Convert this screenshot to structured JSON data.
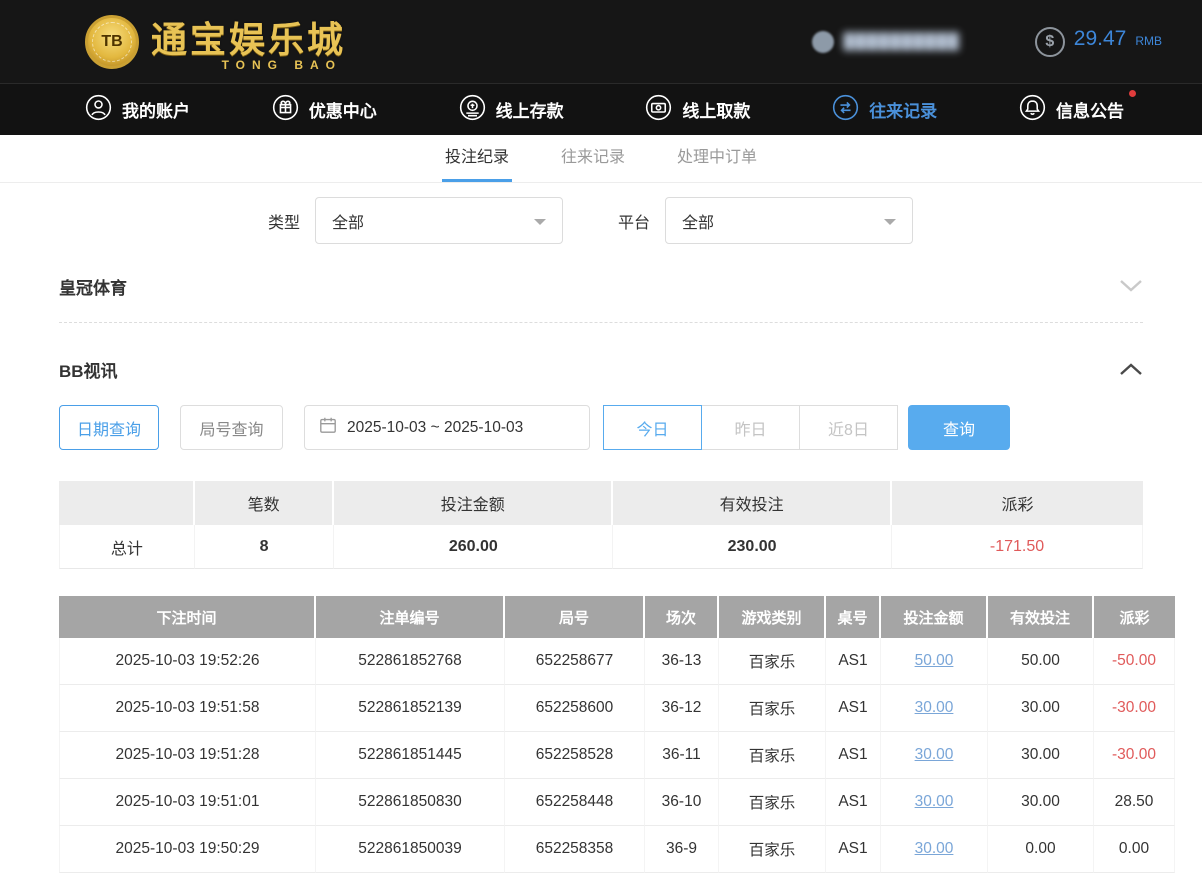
{
  "brand": {
    "badge": "TB",
    "name": "通宝娱乐城",
    "latin": "TONG BAO"
  },
  "topbar": {
    "user_name_masked": "██████████",
    "balance_symbol": "$",
    "balance_amount": "29.47",
    "balance_currency": "RMB"
  },
  "nav": {
    "items": [
      {
        "label": "我的账户"
      },
      {
        "label": "优惠中心"
      },
      {
        "label": "线上存款"
      },
      {
        "label": "线上取款"
      },
      {
        "label": "往来记录"
      },
      {
        "label": "信息公告"
      }
    ]
  },
  "tabs": {
    "items": [
      {
        "label": "投注纪录"
      },
      {
        "label": "往来记录"
      },
      {
        "label": "处理中订单"
      }
    ]
  },
  "filters": {
    "type_label": "类型",
    "type_value": "全部",
    "platform_label": "平台",
    "platform_value": "全部"
  },
  "sections": {
    "crown_sports": "皇冠体育",
    "bb_video": "BB视讯"
  },
  "query": {
    "date_query": "日期查询",
    "round_query": "局号查询",
    "date_range": "2025-10-03 ~ 2025-10-03",
    "today": "今日",
    "yesterday": "昨日",
    "last8": "近8日",
    "search": "查询"
  },
  "summary": {
    "headers": {
      "count": "笔数",
      "bet": "投注金额",
      "valid": "有效投注",
      "payout": "派彩"
    },
    "total_label": "总计",
    "count": "8",
    "bet": "260.00",
    "valid": "230.00",
    "payout": "-171.50"
  },
  "table": {
    "headers": [
      "下注时间",
      "注单编号",
      "局号",
      "场次",
      "游戏类别",
      "桌号",
      "投注金额",
      "有效投注",
      "派彩"
    ],
    "rows": [
      {
        "time": "2025-10-03 19:52:26",
        "id": "522861852768",
        "round": "652258677",
        "session": "36-13",
        "game": "百家乐",
        "desk": "AS1",
        "bet": "50.00",
        "valid": "50.00",
        "payout": "-50.00"
      },
      {
        "time": "2025-10-03 19:51:58",
        "id": "522861852139",
        "round": "652258600",
        "session": "36-12",
        "game": "百家乐",
        "desk": "AS1",
        "bet": "30.00",
        "valid": "30.00",
        "payout": "-30.00"
      },
      {
        "time": "2025-10-03 19:51:28",
        "id": "522861851445",
        "round": "652258528",
        "session": "36-11",
        "game": "百家乐",
        "desk": "AS1",
        "bet": "30.00",
        "valid": "30.00",
        "payout": "-30.00"
      },
      {
        "time": "2025-10-03 19:51:01",
        "id": "522861850830",
        "round": "652258448",
        "session": "36-10",
        "game": "百家乐",
        "desk": "AS1",
        "bet": "30.00",
        "valid": "30.00",
        "payout": "28.50"
      },
      {
        "time": "2025-10-03 19:50:29",
        "id": "522861850039",
        "round": "652258358",
        "session": "36-9",
        "game": "百家乐",
        "desk": "AS1",
        "bet": "30.00",
        "valid": "0.00",
        "payout": "0.00"
      }
    ]
  },
  "colors": {
    "accent_blue": "#4a9fe8",
    "negative_red": "#e05a5a"
  }
}
